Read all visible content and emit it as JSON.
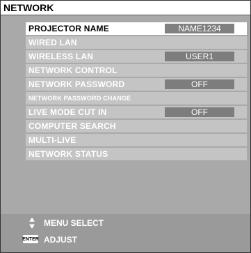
{
  "title": "NETWORK",
  "menu": [
    {
      "label": "PROJECTOR NAME",
      "value": "NAME1234",
      "selected": true
    },
    {
      "label": "WIRED LAN",
      "value": null
    },
    {
      "label": "WIRELESS LAN",
      "value": "USER1"
    },
    {
      "label": "NETWORK CONTROL",
      "value": null
    },
    {
      "label": "NETWORK PASSWORD",
      "value": "OFF"
    },
    {
      "label": "NETWORK PASSWORD CHANGE",
      "value": null,
      "small": true
    },
    {
      "label": "LIVE MODE CUT IN",
      "value": "OFF"
    },
    {
      "label": "COMPUTER SEARCH",
      "value": null
    },
    {
      "label": "MULTI-LIVE",
      "value": null
    },
    {
      "label": "NETWORK STATUS",
      "value": null
    }
  ],
  "footer": {
    "menu_select_icon": "up-down-arrows-icon",
    "menu_select_label": "MENU SELECT",
    "enter_icon_text": "ENTER",
    "adjust_label": "ADJUST"
  }
}
